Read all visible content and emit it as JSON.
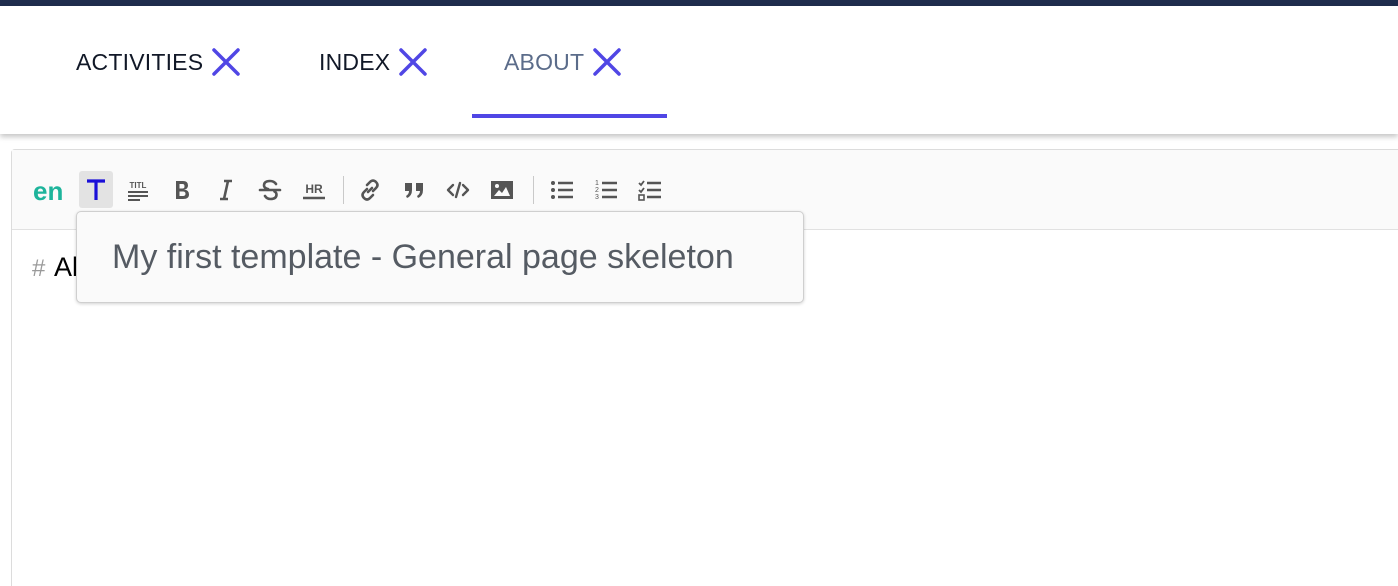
{
  "tabs": [
    {
      "label": "ACTIVITIES",
      "active": false
    },
    {
      "label": "INDEX",
      "active": false
    },
    {
      "label": "ABOUT",
      "active": true
    }
  ],
  "editor": {
    "language": "en",
    "toolbar_buttons": [
      "template",
      "title",
      "bold",
      "italic",
      "strikethrough",
      "horizontal-rule",
      "link",
      "quote",
      "code",
      "image",
      "bulleted-list",
      "numbered-list",
      "checklist"
    ],
    "content": {
      "hash": "#",
      "heading_text": "Al"
    }
  },
  "tooltip": {
    "text": "My first template - General page skeleton"
  },
  "colors": {
    "accent": "#5046e5",
    "lang": "#1db49b",
    "template_icon": "#1a0fd8"
  }
}
